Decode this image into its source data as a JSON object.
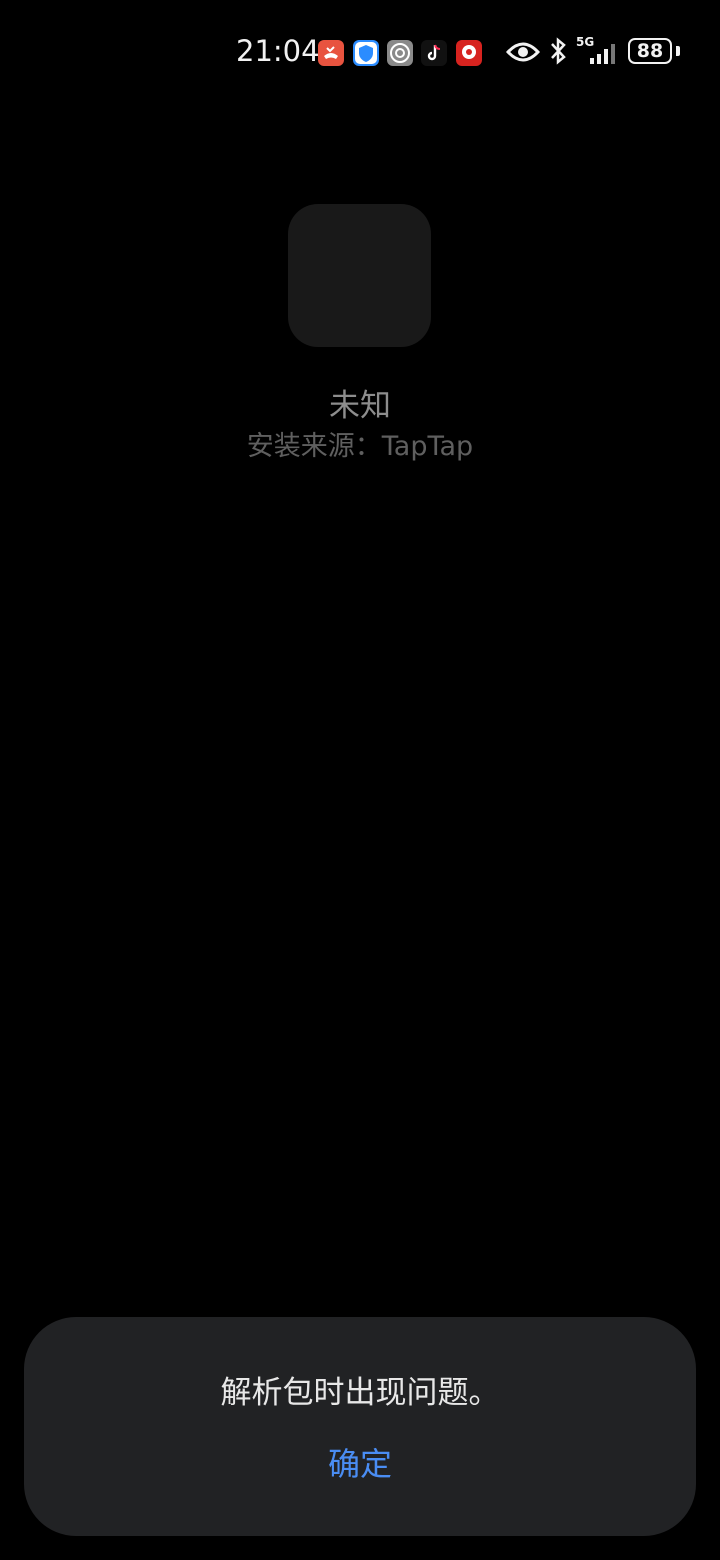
{
  "status_bar": {
    "time": "21:04",
    "network_label": "5G",
    "battery_level": "88",
    "notification_icons": [
      "phone-missed-icon",
      "shield-icon",
      "settings-gear-icon",
      "tiktok-icon",
      "game-app-icon"
    ],
    "indicator_icons": [
      "eye-icon",
      "bluetooth-icon",
      "signal-icon",
      "battery-icon"
    ]
  },
  "app": {
    "name": "未知",
    "source": "安装来源：TapTap"
  },
  "dialog": {
    "message": "解析包时出现问题。",
    "confirm_label": "确定"
  },
  "colors": {
    "background": "#000000",
    "dialog_bg": "#212224",
    "accent": "#4a8df3"
  }
}
